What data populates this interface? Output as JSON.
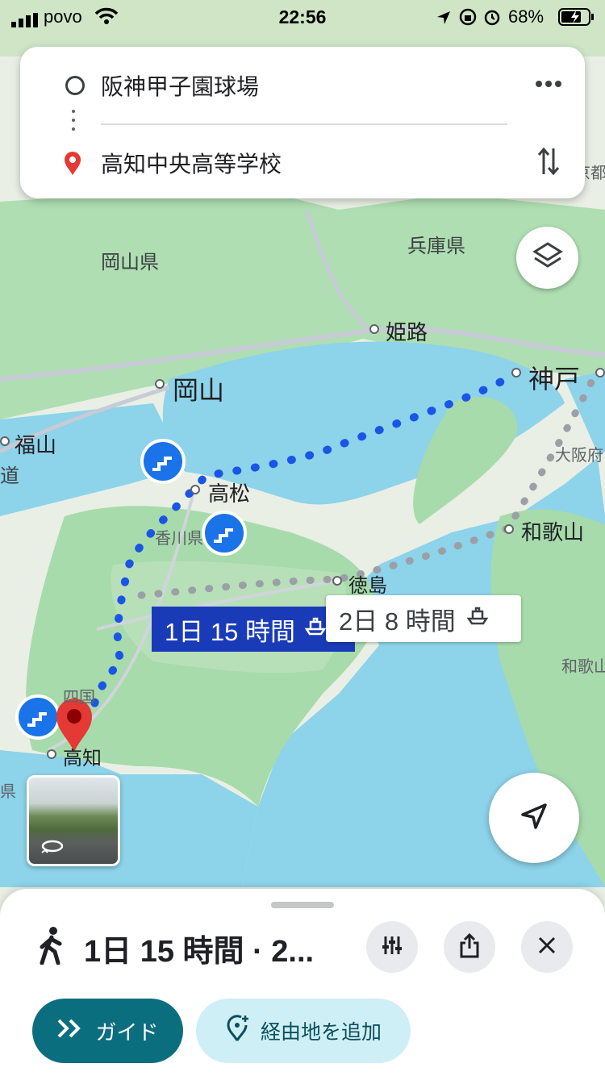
{
  "status_bar": {
    "carrier": "povo",
    "time": "22:56",
    "battery": "68%"
  },
  "search": {
    "origin": "阪神甲子園球場",
    "destination": "高知中央高等学校"
  },
  "map": {
    "labels": {
      "okayama_pref": "岡山県",
      "hyogo_pref": "兵庫県",
      "himeji": "姫路",
      "okayama": "岡山",
      "kobe": "神戸",
      "fukuyama": "福山",
      "takamatsu": "高松",
      "kagawa": "香川県",
      "osaka": "大阪府",
      "wakayama": "和歌山",
      "tokushima": "徳島",
      "shikoku": "四国",
      "kochi": "高知",
      "wakayama_pref": "和歌山",
      "kyoto": "京都",
      "ken_left": "県",
      "do_left": "道"
    },
    "routes": {
      "active_duration": "1日 15 時間",
      "alt_duration": "2日 8 時間"
    }
  },
  "sheet": {
    "summary": "1日 15 時間 · 2...",
    "guide_label": "ガイド",
    "add_waypoint_label": "経由地を追加"
  },
  "colors": {
    "water": "#8dd3ea",
    "land": "#e9efe4",
    "green": "#9fd6a4",
    "route_active": "#1a55e6",
    "route_alt": "#9aa0a6",
    "guide_bg": "#0b6e7f",
    "waypoint_bg": "#cfeff6"
  }
}
